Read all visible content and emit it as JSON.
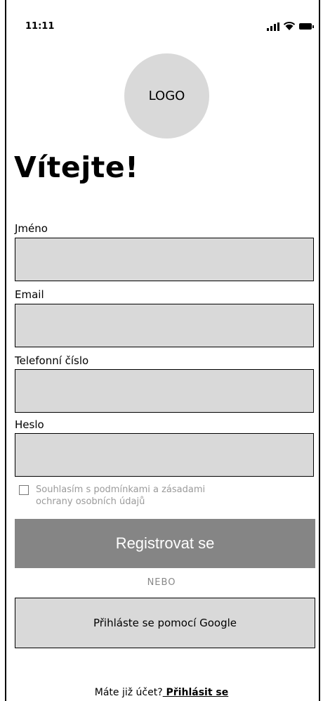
{
  "status_bar": {
    "time": "11:11"
  },
  "logo": {
    "text": "LOGO"
  },
  "heading": "Vítejte!",
  "form": {
    "fields": [
      {
        "label": "Jméno",
        "value": ""
      },
      {
        "label": "Email",
        "value": ""
      },
      {
        "label": "Telefonní číslo",
        "value": ""
      },
      {
        "label": "Heslo",
        "value": ""
      }
    ],
    "consent_text": "Souhlasím s podmínkami a zásadami ochrany osobních údajů",
    "register_label": "Registrovat se",
    "or_label": "NEBO",
    "google_label": "Přihláste se pomocí Google"
  },
  "footer": {
    "question": "Máte již účet?",
    "login_label": " Přihlásit se"
  }
}
